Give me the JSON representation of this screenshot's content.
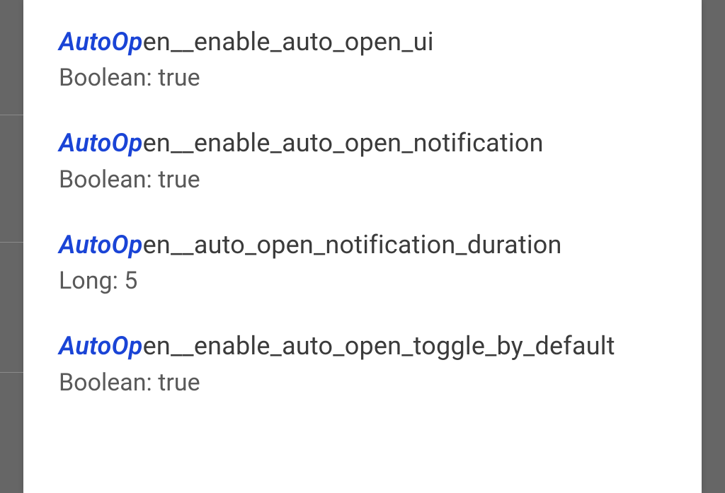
{
  "match_prefix": "AutoOp",
  "entries": [
    {
      "rest": "en__enable_auto_open_ui",
      "type_value": "Boolean: true"
    },
    {
      "rest": "en__enable_auto_open_notification",
      "type_value": "Boolean: true"
    },
    {
      "rest": "en__auto_open_notification_duration",
      "type_value": "Long: 5"
    },
    {
      "rest": "en__enable_auto_open_toggle_by_default",
      "type_value": "Boolean: true"
    }
  ],
  "bg_divider_y": [
    162,
    342,
    526
  ]
}
